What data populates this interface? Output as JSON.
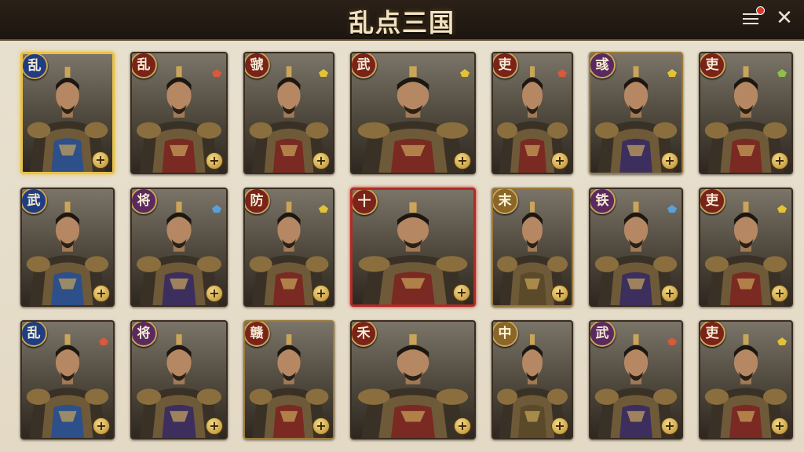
{
  "header": {
    "title": "乱点三国"
  },
  "icons": {
    "menu": "hamburger-menu-icon",
    "notification": "notification-dot-icon",
    "close": "close-icon",
    "slot": "plus-icon"
  },
  "colors": {
    "gold_selected": "#e8c24a",
    "red_selected": "#b32a24",
    "emblem_blue": "#1f3d80",
    "emblem_red": "#7a2318",
    "emblem_purple": "#5a2a5e"
  },
  "grid": {
    "rows": [
      {
        "cards": [
          {
            "emblem": "乱",
            "emblem_color": "blue",
            "highlight": "gold",
            "gem": "",
            "tag": ""
          },
          {
            "emblem": "乱",
            "emblem_color": "red",
            "highlight": "",
            "gem": "r",
            "tag": ""
          },
          {
            "emblem": "虢",
            "emblem_color": "red",
            "highlight": "",
            "gem": "y",
            "tag": ""
          },
          {
            "emblem": "武",
            "emblem_color": "red",
            "highlight": "",
            "gem": "y",
            "tag": ""
          },
          {
            "emblem": "吏",
            "emblem_color": "red",
            "highlight": "",
            "gem": "r",
            "tag": ""
          },
          {
            "emblem": "彧",
            "emblem_color": "purple",
            "highlight": "brass",
            "gem": "y",
            "tag": ""
          },
          {
            "emblem": "吏",
            "emblem_color": "red",
            "highlight": "",
            "gem": "g",
            "tag": ""
          }
        ]
      },
      {
        "cards": [
          {
            "emblem": "武",
            "emblem_color": "blue",
            "highlight": "",
            "gem": "",
            "tag": ""
          },
          {
            "emblem": "将",
            "emblem_color": "purple",
            "highlight": "",
            "gem": "b",
            "tag": ""
          },
          {
            "emblem": "防",
            "emblem_color": "red",
            "highlight": "",
            "gem": "y",
            "tag": ""
          },
          {
            "emblem": "十",
            "emblem_color": "red",
            "highlight": "red",
            "gem": "",
            "tag": ""
          },
          {
            "emblem": "末",
            "emblem_color": "bronze",
            "highlight": "brass",
            "gem": "",
            "tag": ""
          },
          {
            "emblem": "铁",
            "emblem_color": "purple",
            "highlight": "",
            "gem": "b",
            "tag": ""
          },
          {
            "emblem": "吏",
            "emblem_color": "red",
            "highlight": "",
            "gem": "y",
            "tag": ""
          }
        ]
      },
      {
        "cards": [
          {
            "emblem": "乱",
            "emblem_color": "blue",
            "highlight": "",
            "gem": "r",
            "tag": ""
          },
          {
            "emblem": "将",
            "emblem_color": "purple",
            "highlight": "",
            "gem": "",
            "tag": ""
          },
          {
            "emblem": "赣",
            "emblem_color": "red",
            "highlight": "brass",
            "gem": "",
            "tag": ""
          },
          {
            "emblem": "禾",
            "emblem_color": "red",
            "highlight": "",
            "gem": "",
            "tag": ""
          },
          {
            "emblem": "中",
            "emblem_color": "bronze",
            "highlight": "",
            "gem": "",
            "tag": ""
          },
          {
            "emblem": "武",
            "emblem_color": "purple",
            "highlight": "",
            "gem": "r",
            "tag": ""
          },
          {
            "emblem": "吏",
            "emblem_color": "red",
            "highlight": "",
            "gem": "y",
            "tag": ""
          }
        ]
      }
    ]
  }
}
